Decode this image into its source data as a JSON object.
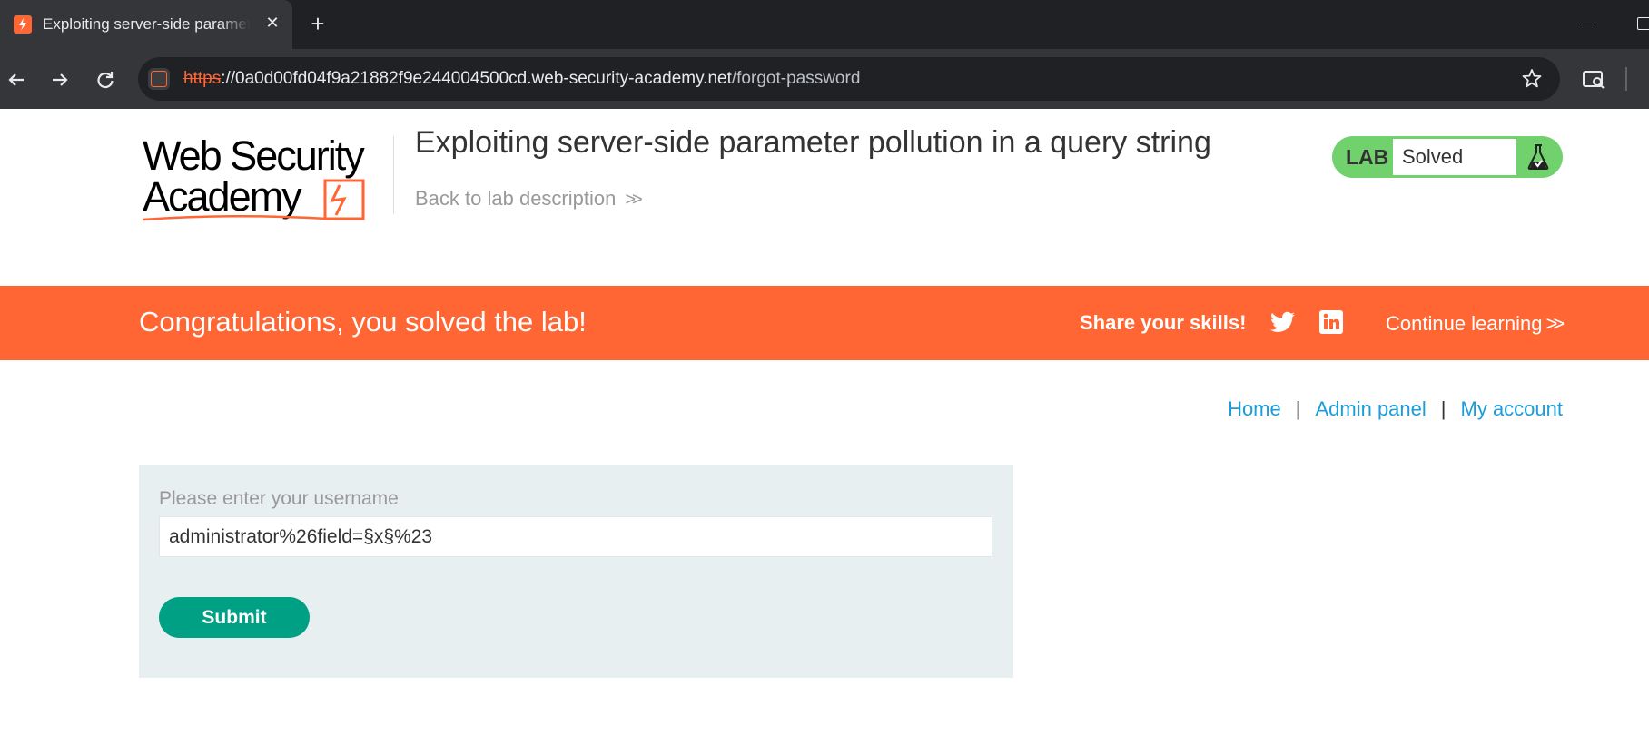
{
  "browser": {
    "tab_title": "Exploiting server-side parameter pollution in a query string",
    "url_scheme": "https",
    "url_rest": "://0a0d00fd04f9a21882f9e244004500cd.web-security-academy.net",
    "url_path": "/forgot-password",
    "icons": [
      "back-arrow-icon",
      "forward-arrow-icon",
      "reload-icon",
      "bookmark-star-icon",
      "tab-search-icon",
      "close-icon",
      "plus-icon"
    ]
  },
  "header": {
    "logo_line1": "Web Security",
    "logo_line2": "Academy",
    "lab_title": "Exploiting server-side parameter pollution in a query string",
    "back_link": "Back to lab description",
    "status_label": "LAB",
    "status_value": "Solved"
  },
  "banner": {
    "congrats": "Congratulations, you solved the lab!",
    "share": "Share your skills!",
    "continue": "Continue learning",
    "icons": [
      "twitter-icon",
      "linkedin-icon"
    ]
  },
  "nav": {
    "home": "Home",
    "separator": "|",
    "admin": "Admin panel",
    "account": "My account"
  },
  "form": {
    "label": "Please enter your username",
    "username_value": "administrator%26field=§x§%23",
    "submit": "Submit"
  },
  "colors": {
    "brand_orange": "#ff6633",
    "solved_green": "#70d16d",
    "link_blue": "#1a9dd9",
    "submit_green": "#00a084",
    "panel_bg": "#e8eff1"
  }
}
